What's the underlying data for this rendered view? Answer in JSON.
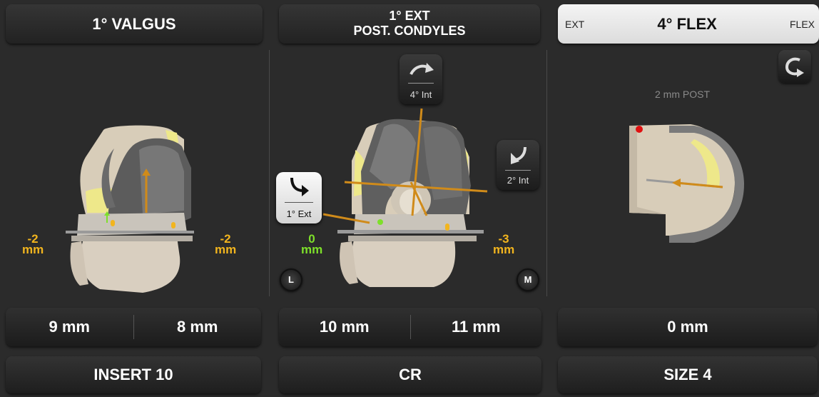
{
  "left_panel": {
    "header": "1° VALGUS",
    "left_gap_value": "-2",
    "right_gap_value": "-2",
    "unit": "mm",
    "gap_left": "9 mm",
    "gap_right": "8 mm",
    "bottom_button": "INSERT 10"
  },
  "middle_panel": {
    "header_line1": "1° EXT",
    "header_line2": "POST. CONDYLES",
    "rotation_top": "4° Int",
    "rotation_right": "2° Int",
    "rotation_left": "1° Ext",
    "left_gap_value": "0",
    "right_gap_value": "-3",
    "unit": "mm",
    "lateral_button": "L",
    "medial_button": "M",
    "gap_left": "10 mm",
    "gap_right": "11 mm",
    "bottom_button": "CR"
  },
  "right_panel": {
    "ext_label": "EXT",
    "header": "4° FLEX",
    "flex_label": "FLEX",
    "post_text": "2 mm POST",
    "gap_value": "0 mm",
    "bottom_button": "SIZE 4"
  },
  "colors": {
    "accent_orange": "#f2b51e",
    "accent_green": "#7ee02a",
    "background": "#2b2b2b"
  },
  "icons": [
    "rotate-external-icon",
    "rotate-internal-icon",
    "refresh-icon"
  ]
}
